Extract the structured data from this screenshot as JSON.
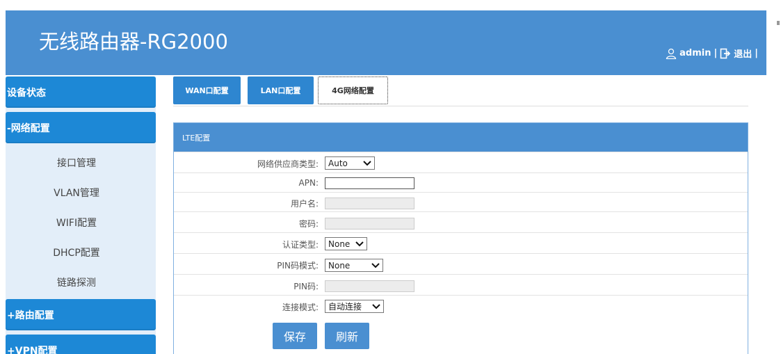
{
  "header": {
    "title": "无线路由器-RG2000",
    "user": "admin",
    "separator": "|",
    "logout": "退出",
    "separator_end": "|"
  },
  "sidebar": {
    "device_status": "设备状态",
    "network_config": "-网络配置",
    "sub_items": [
      "接口管理",
      "VLAN管理",
      "WIFI配置",
      "DHCP配置",
      "链路探测"
    ],
    "route_config": "+路由配置",
    "vpn_config": "+VPN配置"
  },
  "tabs": [
    "WAN口配置",
    "LAN口配置",
    "4G网络配置"
  ],
  "panel": {
    "title": "LTE配置",
    "fields": {
      "provider_label": "网络供应商类型:",
      "provider_value": "Auto",
      "apn_label": "APN:",
      "apn_value": "",
      "username_label": "用户名:",
      "password_label": "密码:",
      "auth_label": "认证类型:",
      "auth_value": "None",
      "pin_mode_label": "PIN码模式:",
      "pin_mode_value": "None",
      "pin_label": "PIN码:",
      "conn_label": "连接模式:",
      "conn_value": "自动连接"
    },
    "save": "保存",
    "refresh": "刷新"
  },
  "colors": {
    "header_bg": "#4a8fd1",
    "sidebar_head": "#1d88d6",
    "sidebar_bg": "#e3eef9"
  }
}
